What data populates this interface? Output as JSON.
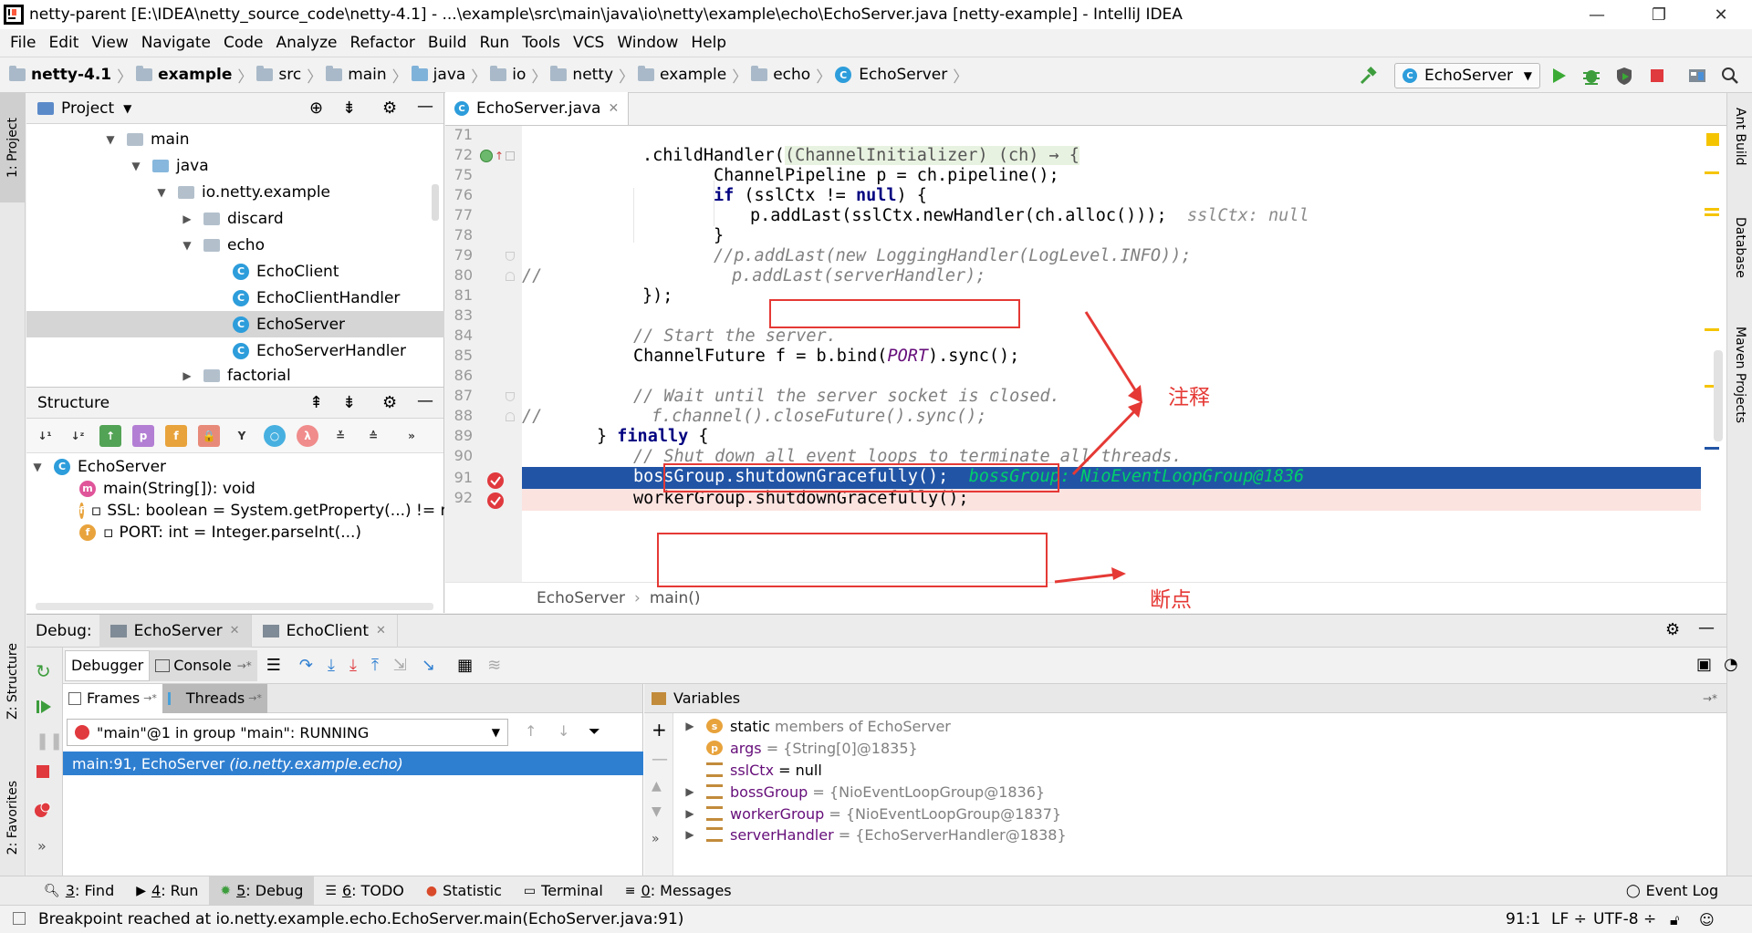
{
  "window": {
    "title": "netty-parent [E:\\IDEA\\netty_source_code\\netty-4.1] - ...\\example\\src\\main\\java\\io\\netty\\example\\echo\\EchoServer.java [netty-example] - IntelliJ IDEA",
    "minimize": "—",
    "maximize": "❐",
    "close": "✕"
  },
  "menu": [
    "File",
    "Edit",
    "View",
    "Navigate",
    "Code",
    "Analyze",
    "Refactor",
    "Build",
    "Run",
    "Tools",
    "VCS",
    "Window",
    "Help"
  ],
  "breadcrumbs": [
    "netty-4.1",
    "example",
    "src",
    "main",
    "java",
    "io",
    "netty",
    "example",
    "echo",
    "EchoServer"
  ],
  "run_config": "EchoServer",
  "project_panel": {
    "title": "Project",
    "tree": [
      {
        "label": "main",
        "kind": "folder",
        "expanded": true
      },
      {
        "label": "java",
        "kind": "folder-blue",
        "expanded": true
      },
      {
        "label": "io.netty.example",
        "kind": "package",
        "expanded": true
      },
      {
        "label": "discard",
        "kind": "package",
        "expanded": false
      },
      {
        "label": "echo",
        "kind": "package",
        "expanded": true
      },
      {
        "label": "EchoClient",
        "kind": "class-run"
      },
      {
        "label": "EchoClientHandler",
        "kind": "class"
      },
      {
        "label": "EchoServer",
        "kind": "class-run",
        "selected": true
      },
      {
        "label": "EchoServerHandler",
        "kind": "class"
      },
      {
        "label": "factorial",
        "kind": "package",
        "expanded": false
      }
    ]
  },
  "structure_panel": {
    "title": "Structure",
    "root": "EchoServer",
    "members": [
      {
        "icon": "m",
        "text": "main(String[]): void"
      },
      {
        "icon": "f",
        "text": "SSL: boolean = System.getProperty(...) != nu"
      },
      {
        "icon": "f",
        "text": "PORT: int = Integer.parseInt(...)"
      }
    ]
  },
  "editor": {
    "tab": "EchoServer.java",
    "line_numbers": [
      "71",
      "72",
      "75",
      "76",
      "77",
      "78",
      "79",
      "80",
      "81",
      "83",
      "84",
      "85",
      "86",
      "87",
      "88",
      "89",
      "90",
      "91",
      "92"
    ],
    "breadcrumb": [
      "EchoServer",
      "main()"
    ],
    "code": {
      "l72a": ".childHandler(",
      "l72b": "(ChannelInitializer) (ch) → {",
      "l75": "ChannelPipeline p = ch.pipeline();",
      "l76_kw": "if",
      "l76_a": " (sslCtx != ",
      "l76_null": "null",
      "l76_b": ") {",
      "l77": "p.addLast(sslCtx.newHandler(ch.alloc()));",
      "l77_hint": "sslCtx: null",
      "l78": "}",
      "l79": "//p.addLast(new LoggingHandler(LogLevel.INFO));",
      "l80_prefix": "//",
      "l80": "p.addLast(serverHandler);",
      "l81": "});",
      "l84": "// Start the server.",
      "l85a": "ChannelFuture f = b.bind(",
      "l85b": "PORT",
      "l85c": ").sync();",
      "l87": "// Wait until the server socket is closed.",
      "l88_prefix": "//",
      "l88": "f.channel().closeFuture().sync();",
      "l89a": "} ",
      "l89b": "finally",
      "l89c": " {",
      "l90": "// Shut down all event loops to terminate all threads.",
      "l91": "bossGroup.shutdownGracefully();",
      "l91_hint": "bossGroup: NioEventLoopGroup@1836",
      "l92": "workerGroup.shutdownGracefully();"
    },
    "annotations": {
      "comment_label": "注释",
      "breakpoint_label": "断点"
    }
  },
  "debug": {
    "title": "Debug:",
    "tabs": [
      "EchoServer",
      "EchoClient"
    ],
    "subtabs": [
      "Debugger",
      "Console"
    ],
    "frames_tab": "Frames",
    "threads_tab": "Threads",
    "thread_select": "\"main\"@1 in group \"main\": RUNNING",
    "frame_line": "main:91, EchoServer",
    "frame_pkg": "(io.netty.example.echo)",
    "variables_title": "Variables",
    "variables": [
      {
        "icon": "s",
        "name": "static",
        "value": "members of EchoServer",
        "expandable": true
      },
      {
        "icon": "p",
        "name": "args",
        "value": "= {String[0]@1835}",
        "expandable": false
      },
      {
        "icon": "bars",
        "name": "sslCtx",
        "value": "= null",
        "expandable": false
      },
      {
        "icon": "bars",
        "name": "bossGroup",
        "value": "= {NioEventLoopGroup@1836}",
        "expandable": true
      },
      {
        "icon": "bars",
        "name": "workerGroup",
        "value": "= {NioEventLoopGroup@1837}",
        "expandable": true
      },
      {
        "icon": "bars",
        "name": "serverHandler",
        "value": "= {EchoServerHandler@1838}",
        "expandable": true
      }
    ]
  },
  "left_strip": [
    "1: Project",
    "Z: Structure",
    "2: Favorites"
  ],
  "right_strip": [
    "Ant Build",
    "Database",
    "Maven Projects"
  ],
  "tool_windows": [
    {
      "num": "3",
      "label": ": Find"
    },
    {
      "num": "4",
      "label": ": Run"
    },
    {
      "num": "5",
      "label": ": Debug",
      "active": true
    },
    {
      "num": "6",
      "label": ": TODO"
    },
    {
      "num": "",
      "label": "Statistic"
    },
    {
      "num": "",
      "label": "Terminal"
    },
    {
      "num": "0",
      "label": ": Messages"
    }
  ],
  "event_log": "Event Log",
  "status": {
    "message": "Breakpoint reached at io.netty.example.echo.EchoServer.main(EchoServer.java:91)",
    "position": "91:1",
    "line_sep": "LF ÷",
    "encoding": "UTF-8 ÷"
  }
}
